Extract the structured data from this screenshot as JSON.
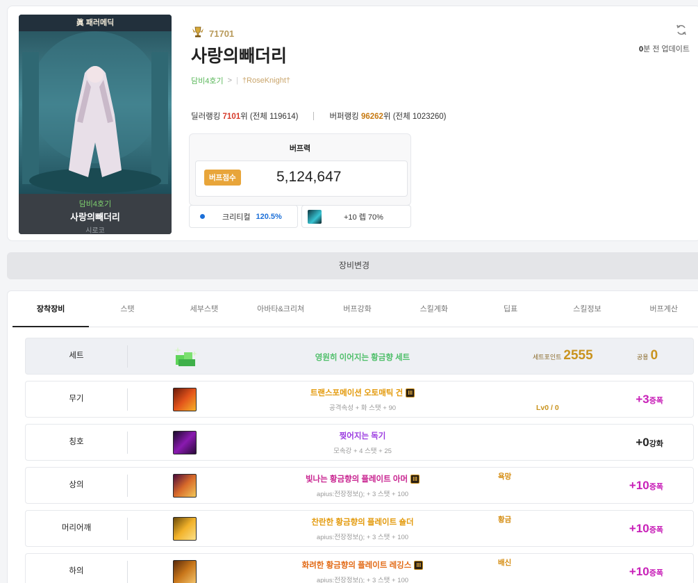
{
  "portrait": {
    "top_label": "眞 패러메딕",
    "guild": "담비4호기",
    "name": "사랑의빼더리",
    "server": "시로코"
  },
  "profile": {
    "rank_icon": "trophy-wings-icon",
    "rank_number": "71701",
    "name": "사랑의빼더리",
    "guild": "담비4호기",
    "guild_chevron": ">",
    "guild_sep": "|",
    "adventure": "†RoseKnight†",
    "update_count": "0",
    "update_suffix": "분 전 업데이트",
    "dealer_label": "딜러랭킹",
    "dealer_rank": "7101",
    "dealer_rank_suffix": "위 (전체 119614)",
    "buffer_label": "버퍼랭킹",
    "buffer_rank": "96262",
    "buffer_rank_suffix": "위 (전체 1023260)"
  },
  "buff": {
    "title": "버프력",
    "badge": "버프점수",
    "score": "5,124,647",
    "crit_label": "크리티컬",
    "crit_value": "120.5%",
    "item_label": "+10 렙 70%"
  },
  "equip_change": "장비변경",
  "tabs": [
    "장착장비",
    "스탯",
    "세부스탯",
    "아바타&크리쳐",
    "버프강화",
    "스킬계화",
    "딥표",
    "스킬정보",
    "버프계산"
  ],
  "set_row": {
    "label": "세트",
    "name": "영원히 이어지는 황금향 세트",
    "point_label": "세트포인트",
    "point_value": "2555",
    "common_label": "공용",
    "common_value": "0"
  },
  "rows": [
    {
      "label": "무기",
      "name": "트랜스포메이션 오토매틱 건",
      "grade": "III",
      "sub": "공격속성 + 화 스탯 + 90",
      "tag": "Lv0 / 0",
      "upgrade_num": "+3",
      "upgrade_unit": "증폭"
    },
    {
      "label": "칭호",
      "name": "찢어지는 독기",
      "grade": "",
      "sub": "모속강 + 4 스탯 + 25",
      "tag": "",
      "upgrade_num": "+0",
      "upgrade_unit": "강화"
    },
    {
      "label": "상의",
      "name": "빛나는 황금향의 플레이트 아머",
      "grade": "III",
      "sub": "apius:전장정보(); + 3 스탯 + 100",
      "tag": "욕망",
      "upgrade_num": "+10",
      "upgrade_unit": "증폭"
    },
    {
      "label": "머리어깨",
      "name": "찬란한 황금향의 플레이트 숄더",
      "grade": "",
      "sub": "apius:전장정보(); + 3 스탯 + 100",
      "tag": "황금",
      "upgrade_num": "+10",
      "upgrade_unit": "증폭"
    },
    {
      "label": "하의",
      "name": "화려한 황금향의 플레이트 레깅스",
      "grade": "III",
      "sub": "apius:전장정보(); + 3 스탯 + 100",
      "tag": "배신",
      "upgrade_num": "+10",
      "upgrade_unit": "증폭"
    }
  ],
  "colors": {
    "set_green": "#4fbf6a",
    "weapon_orange": "#e39a0c",
    "title_purple": "#9b3be0",
    "armor_magenta": "#c8228f",
    "gold_name": "#e39a0c",
    "leg_orange": "#e26a16",
    "point_gold": "#c9931e"
  }
}
